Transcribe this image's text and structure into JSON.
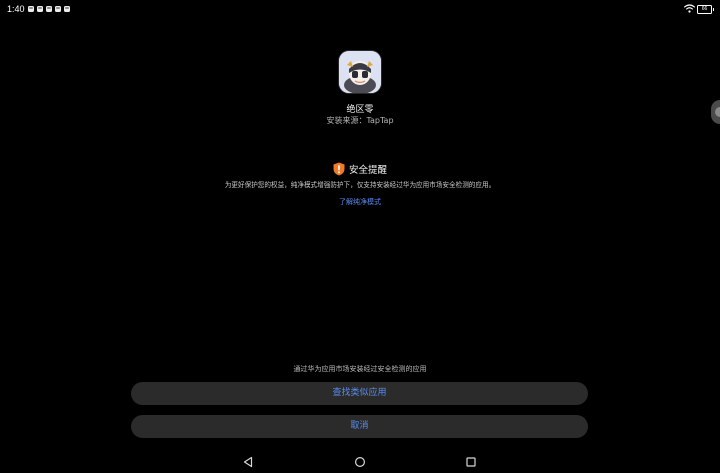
{
  "status_bar": {
    "time": "1:40",
    "notification_icons": [
      "notification-icon",
      "notification-icon",
      "notification-icon",
      "notification-icon",
      "notification-icon"
    ],
    "battery_level": "66"
  },
  "app": {
    "icon": "app-logo-icon",
    "name": "绝区零",
    "install_source": "安装来源：TapTap"
  },
  "security": {
    "icon": "shield-alert-icon",
    "title": "安全提醒",
    "description": "为更好保护您的权益，纯净模式增强防护下，仅支持安装经过华为应用市场安全检测的应用。",
    "link_label": "了解纯净模式"
  },
  "footer": {
    "hint": "通过华为应用市场安装经过安全检测的应用",
    "primary_button": "查找类似应用",
    "cancel_button": "取消"
  },
  "nav": {
    "back": "back-triangle-icon",
    "home": "home-circle-icon",
    "recent": "recent-square-icon"
  },
  "colors": {
    "background": "#000000",
    "accent": "#5a8cf2",
    "button_bg": "#2b2b2b",
    "warning": "#f07a2a"
  }
}
